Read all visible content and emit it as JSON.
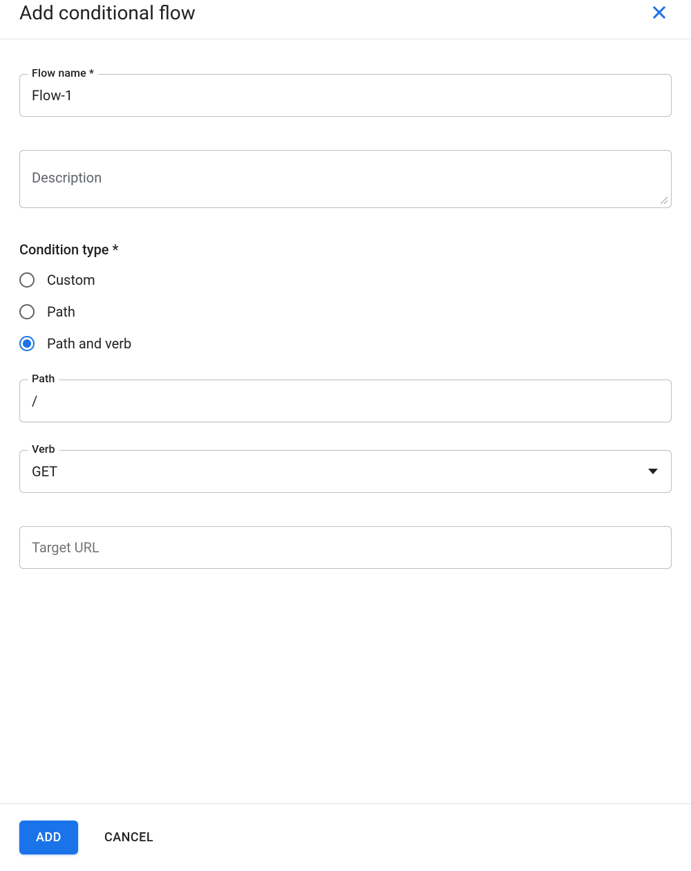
{
  "header": {
    "title": "Add conditional flow"
  },
  "form": {
    "flowName": {
      "label": "Flow name *",
      "value": "Flow-1"
    },
    "description": {
      "placeholder": "Description",
      "value": ""
    },
    "conditionType": {
      "label": "Condition type *",
      "options": [
        {
          "label": "Custom",
          "selected": false
        },
        {
          "label": "Path",
          "selected": false
        },
        {
          "label": "Path and verb",
          "selected": true
        }
      ]
    },
    "path": {
      "label": "Path",
      "value": "/"
    },
    "verb": {
      "label": "Verb",
      "value": "GET"
    },
    "targetUrl": {
      "placeholder": "Target URL",
      "value": ""
    }
  },
  "footer": {
    "add": "ADD",
    "cancel": "CANCEL"
  }
}
